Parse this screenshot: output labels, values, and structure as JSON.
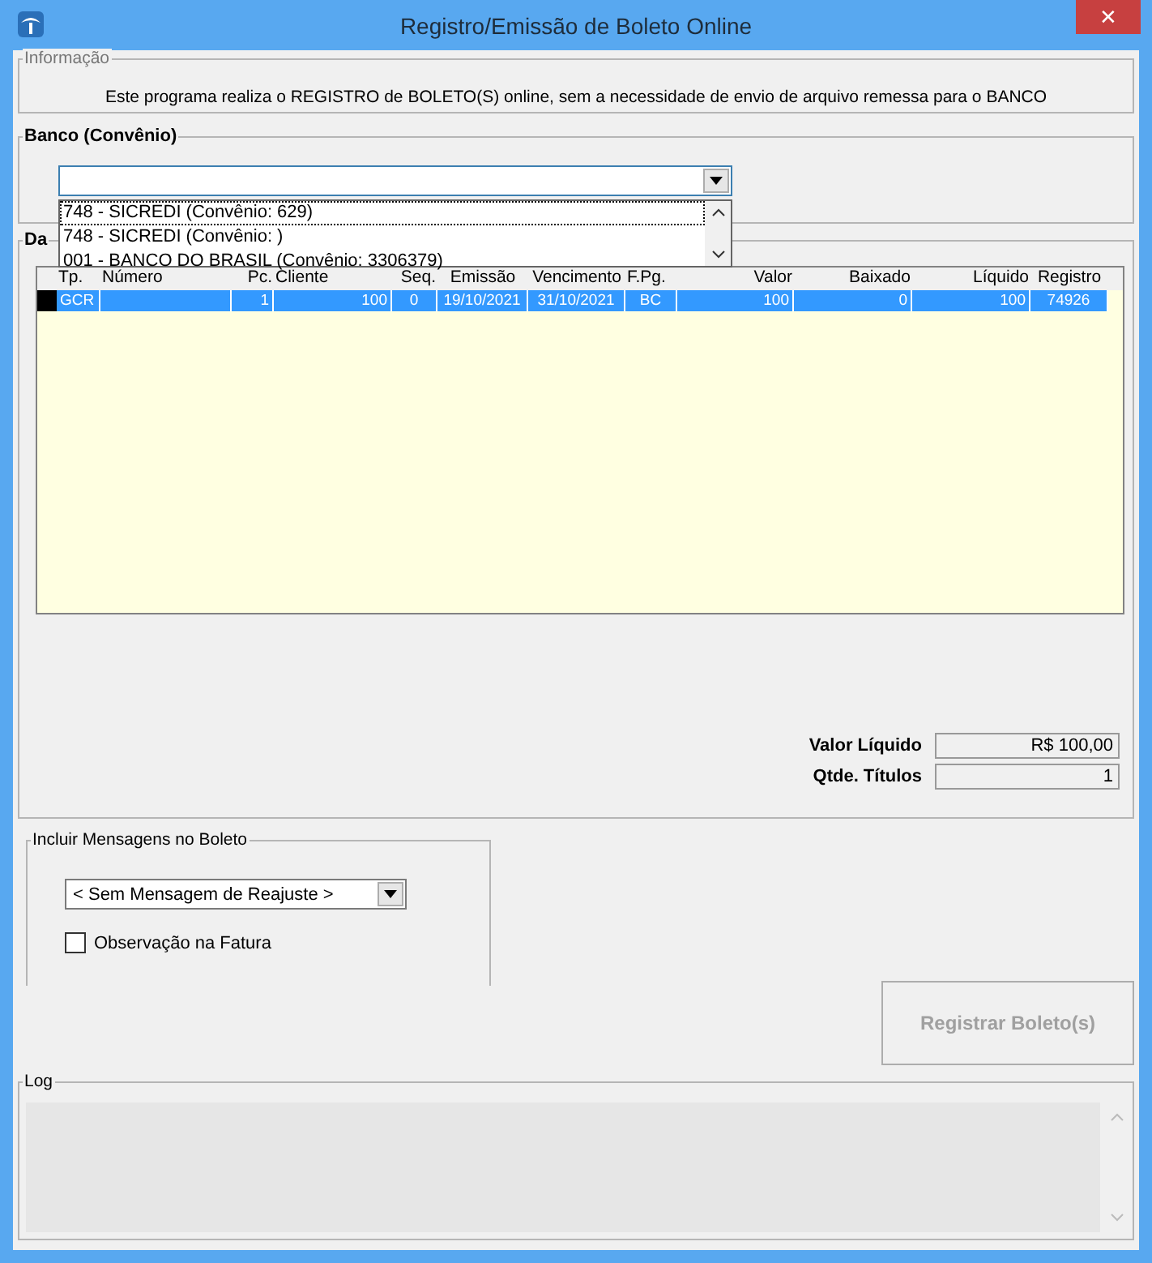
{
  "window": {
    "title": "Registro/Emissão de Boleto Online",
    "close_label": "✕"
  },
  "information": {
    "label": "Informação",
    "text": "Este programa realiza o REGISTRO de BOLETO(S) online, sem a necessidade de envio de arquivo remessa para o BANCO"
  },
  "bank": {
    "label": "Banco (Convênio)",
    "expanded": true,
    "options": [
      {
        "label": "748 - SICREDI (Convênio: 629)",
        "selected": true
      },
      {
        "label": "748 - SICREDI (Convênio: )",
        "selected": false
      },
      {
        "label": "001 - BANCO DO BRASIL (Convênio: 3306379)",
        "selected": false
      }
    ]
  },
  "data_group": {
    "label": "Da"
  },
  "table": {
    "columns": [
      "Tp.",
      "Número",
      "Pc.",
      "Cliente",
      "Seq.",
      "Emissão",
      "Vencimento",
      "F.Pg.",
      "Valor",
      "Baixado",
      "Líquido",
      "Registro"
    ],
    "rows": [
      {
        "selected": true,
        "cells": [
          "GCR",
          "",
          "1",
          "100",
          "0",
          "19/10/2021",
          "31/10/2021",
          "BC",
          "100",
          "0",
          "100",
          "74926"
        ]
      }
    ]
  },
  "totals": [
    {
      "label": "Valor Líquido",
      "value": "R$ 100,00"
    },
    {
      "label": "Qtde. Títulos",
      "value": "1"
    }
  ],
  "messages": {
    "label": "Incluir Mensagens no Boleto",
    "value": "< Sem Mensagem de Reajuste >",
    "checkbox": {
      "label": "Observação na Fatura",
      "checked": false
    }
  },
  "register_button": {
    "label": "Registrar Boleto(s)",
    "disabled": true
  },
  "log": {
    "label": "Log"
  }
}
